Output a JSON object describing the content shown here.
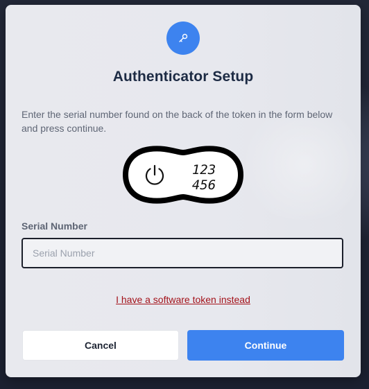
{
  "dialog": {
    "title": "Authenticator Setup",
    "icon": "key-icon",
    "accent_color": "#3d83ef",
    "instructions": "Enter the serial number found on the back of the token in the form below and press continue.",
    "token_illustration": {
      "icon": "power-icon",
      "display_code": "123 456"
    },
    "serial_field": {
      "label": "Serial Number",
      "placeholder": "Serial Number",
      "value": ""
    },
    "software_token_link": "I have a software token instead",
    "link_color": "#a3121a",
    "buttons": {
      "cancel_label": "Cancel",
      "continue_label": "Continue"
    }
  }
}
